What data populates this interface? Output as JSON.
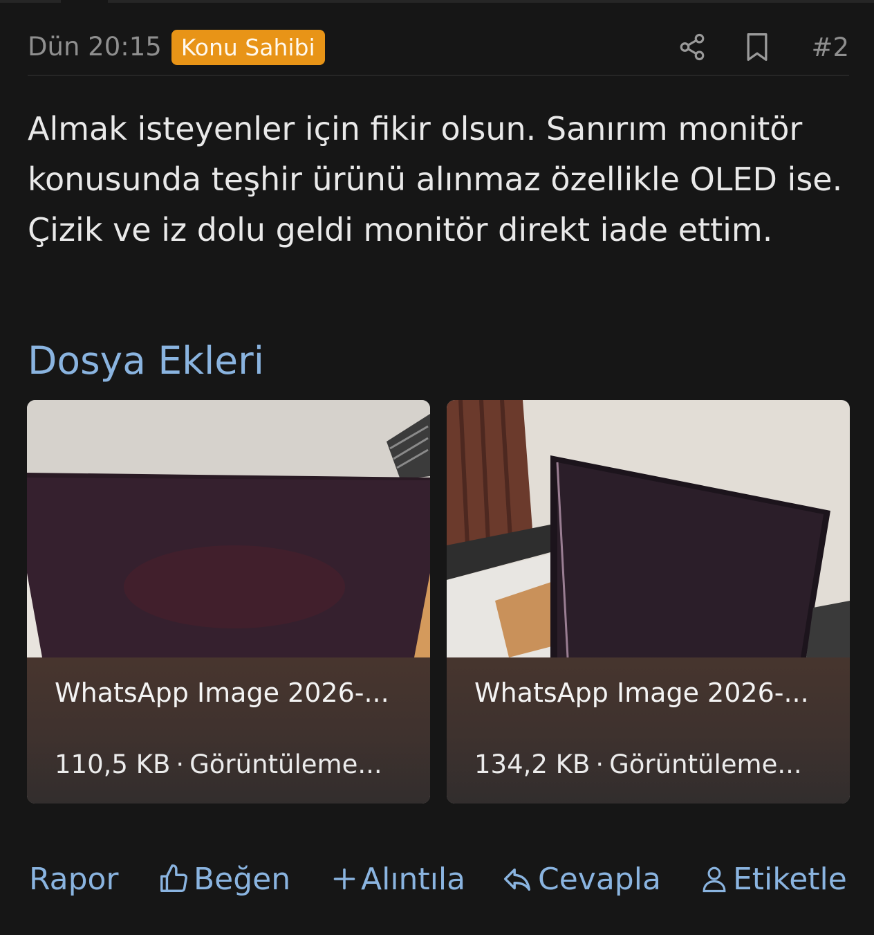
{
  "post": {
    "time": "Dün 20:15",
    "owner_badge": "Konu Sahibi",
    "number": "#2",
    "body": "Almak isteyenler için fikir olsun. Sanırım monitör konusunda teşhir ürünü alınmaz özellikle OLED ise. Çizik ve iz dolu geldi monitör direkt iade ettim.",
    "icons": {
      "share": "share-icon",
      "bookmark": "bookmark-icon"
    },
    "colors": {
      "badge": "#e89417",
      "link": "#8ab4e0",
      "background": "#161616"
    }
  },
  "attachments": {
    "title": "Dosya Ekleri",
    "items": [
      {
        "name": "WhatsApp Image 2026-...",
        "size": "110,5 KB",
        "separator": "·",
        "views": "Görüntüleme..."
      },
      {
        "name": "WhatsApp Image 2026-...",
        "size": "134,2 KB",
        "separator": "·",
        "views": "Görüntüleme..."
      }
    ]
  },
  "actions": {
    "report": "Rapor",
    "like": "Beğen",
    "quote": "Alıntıla",
    "reply": "Cevapla",
    "tag": "Etiketle"
  }
}
